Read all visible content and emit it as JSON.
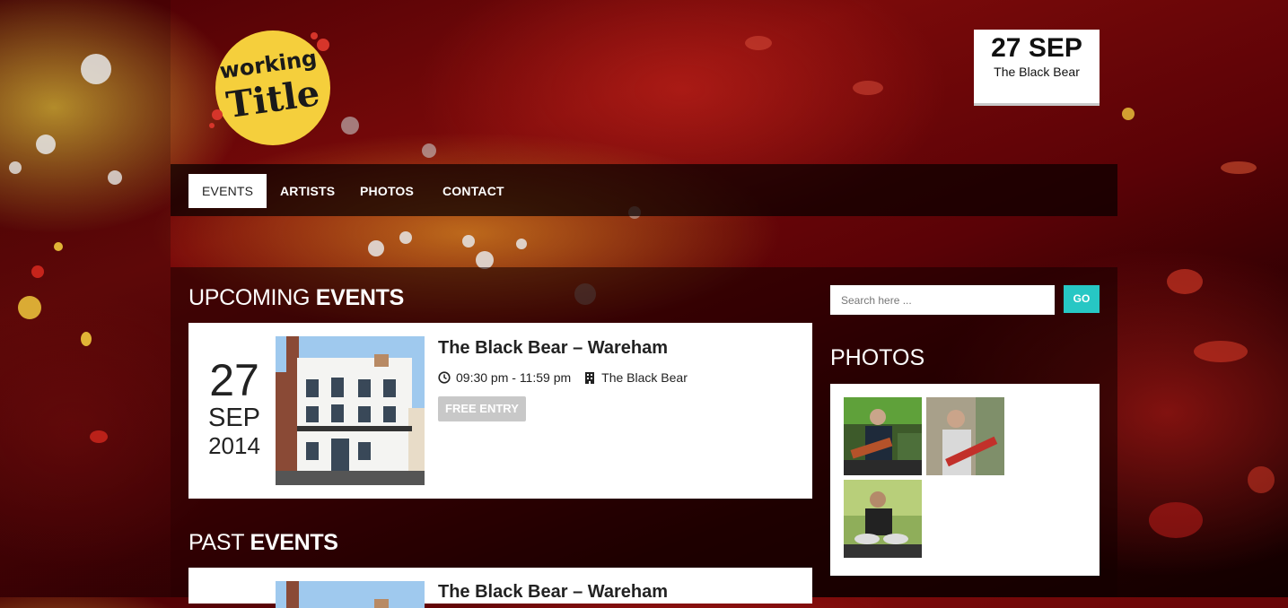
{
  "site": {
    "logo_text_line1": "working",
    "logo_text_line2": "Title"
  },
  "next_event_box": {
    "date": "27 SEP",
    "venue": "The Black Bear"
  },
  "nav": {
    "items": [
      {
        "label": "EVENTS",
        "active": true
      },
      {
        "label": "ARTISTS",
        "active": false
      },
      {
        "label": "PHOTOS",
        "active": false
      },
      {
        "label": "CONTACT",
        "active": false
      }
    ]
  },
  "upcoming": {
    "title_light": "UPCOMING",
    "title_bold": "EVENTS",
    "event": {
      "day": "27",
      "month": "SEP",
      "year": "2014",
      "title": "The Black Bear – Wareham",
      "time": "09:30 pm - 11:59 pm",
      "venue": "The Black Bear",
      "badge": "FREE ENTRY"
    }
  },
  "past": {
    "title_light": "PAST",
    "title_bold": "EVENTS",
    "event": {
      "title": "The Black Bear – Wareham"
    }
  },
  "search": {
    "placeholder": "Search here ...",
    "button": "GO"
  },
  "photos": {
    "title": "PHOTOS",
    "count": 3
  },
  "colors": {
    "accent": "#27c7c4",
    "logo_yellow": "#f5cf3c",
    "badge_grey": "#c8c8c8"
  }
}
